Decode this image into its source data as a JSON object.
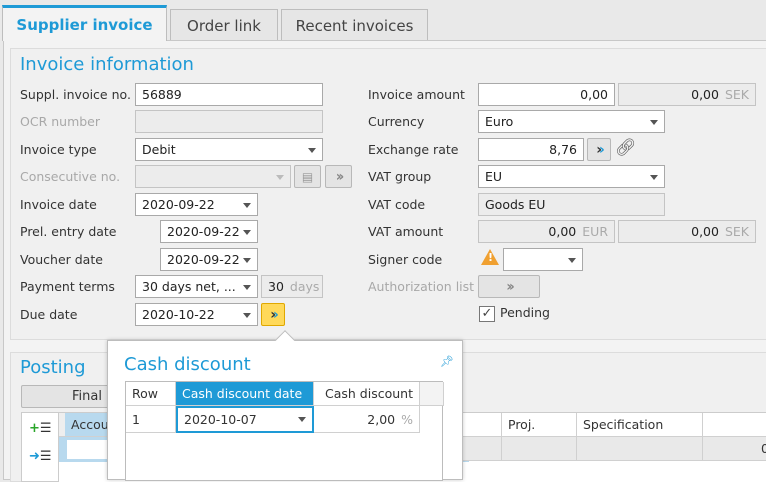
{
  "tabs": [
    {
      "label": "Supplier invoice",
      "active": true
    },
    {
      "label": "Order link"
    },
    {
      "label": "Recent invoices"
    }
  ],
  "invoice_info": {
    "title": "Invoice information",
    "suppl_invoice_no": {
      "label": "Suppl. invoice no.",
      "value": "56889"
    },
    "ocr_number": {
      "label": "OCR number",
      "value": ""
    },
    "invoice_type": {
      "label": "Invoice type",
      "value": "Debit"
    },
    "consecutive_no": {
      "label": "Consecutive no.",
      "value": ""
    },
    "invoice_date": {
      "label": "Invoice date",
      "value": "2020-09-22"
    },
    "prel_entry_date": {
      "label": "Prel. entry date",
      "value": "2020-09-22"
    },
    "voucher_date": {
      "label": "Voucher date",
      "value": "2020-09-22"
    },
    "payment_terms": {
      "label": "Payment terms",
      "value": "30 days net, ...",
      "days": "30",
      "days_unit": "days"
    },
    "due_date": {
      "label": "Due date",
      "value": "2020-10-22"
    },
    "invoice_amount": {
      "label": "Invoice amount",
      "value": "0,00",
      "sek_value": "0,00",
      "sek_unit": "SEK"
    },
    "currency": {
      "label": "Currency",
      "value": "Euro"
    },
    "exchange_rate": {
      "label": "Exchange rate",
      "value": "8,76"
    },
    "vat_group": {
      "label": "VAT group",
      "value": "EU"
    },
    "vat_code": {
      "label": "VAT code",
      "value": "Goods EU"
    },
    "vat_amount": {
      "label": "VAT amount",
      "value": "0,00",
      "unit": "EUR",
      "sek_value": "0,00",
      "sek_unit": "SEK"
    },
    "signer_code": {
      "label": "Signer code",
      "value": ""
    },
    "authorization_list": {
      "label": "Authorization list"
    },
    "pending": {
      "label": "Pending",
      "checked": true
    }
  },
  "posting": {
    "title": "Posting",
    "final_button": "Final",
    "columns": [
      "Accou",
      "Proj.",
      "Specification",
      ""
    ],
    "row_last": "0"
  },
  "cash_discount": {
    "title": "Cash discount",
    "columns": [
      "Row",
      "Cash discount date",
      "Cash discount"
    ],
    "rows": [
      {
        "row": "1",
        "date": "2020-10-07",
        "discount": "2,00",
        "unit": "%"
      }
    ]
  },
  "colors": {
    "accent": "#1e9ad6",
    "warning": "#f0a030",
    "highlight_button": "#ffd95a"
  }
}
